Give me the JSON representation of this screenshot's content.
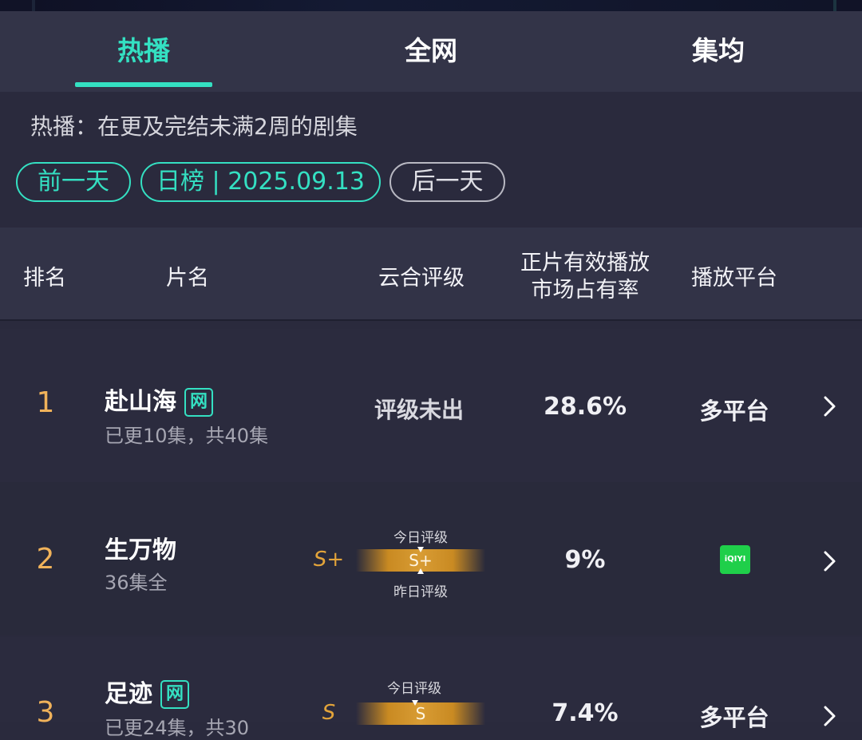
{
  "tabs": [
    {
      "label": "热播",
      "active": true
    },
    {
      "label": "全网",
      "active": false
    },
    {
      "label": "集均",
      "active": false
    }
  ],
  "description": "热播：在更及完结未满2周的剧集",
  "date_controls": {
    "prev": "前一天",
    "current": "日榜 | 2025.09.13",
    "next": "后一天"
  },
  "table_header": {
    "rank": "排名",
    "title": "片名",
    "rating": "云合评级",
    "share_line1": "正片有效播放",
    "share_line2": "市场占有率",
    "platform": "播放平台"
  },
  "gauge_labels": {
    "today": "今日评级",
    "yesterday": "昨日评级"
  },
  "rows": [
    {
      "rank": "1",
      "title": "赴山海",
      "badge": "网",
      "episodes": "已更10集，共40集",
      "rating_text": "评级未出",
      "share": "28.6%",
      "platform": "多平台"
    },
    {
      "rank": "2",
      "title": "生万物",
      "episodes": "36集全",
      "grade": "S+",
      "gauge_value": "S+",
      "share": "9%",
      "platform_logo": "iQIYI"
    },
    {
      "rank": "3",
      "title": "足迹",
      "badge": "网",
      "episodes": "已更24集，共30",
      "grade": "S",
      "gauge_value": "S",
      "share": "7.4%",
      "platform": "多平台"
    }
  ],
  "colors": {
    "accent": "#34e0c2",
    "gold": "#e3a43a",
    "rank": "#f0b25a",
    "iqiyi": "#1fcf4a"
  },
  "icons": [
    "chevron-right-icon",
    "iqiyi-logo",
    "watermark-logo"
  ]
}
